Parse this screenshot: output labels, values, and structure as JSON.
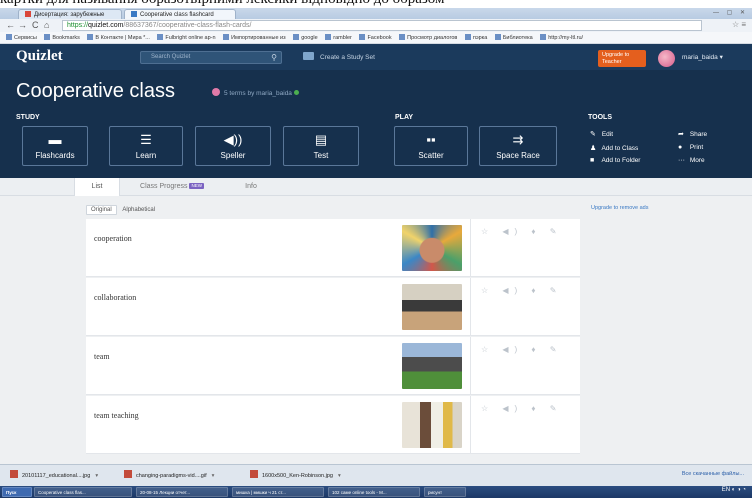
{
  "caption": "картки для називання образотвірними лексики відповідно до образом",
  "browser": {
    "tabs": [
      {
        "label": "Дисертация: зарубежные",
        "fav_color": "#d9473b"
      },
      {
        "label": "Cooperative class flashcard",
        "fav_color": "#3a79c4"
      }
    ],
    "url": {
      "scheme": "https://",
      "host": "quizlet.com",
      "path": "/88637367/cooperative-class-flash-cards/"
    },
    "bookmarks": [
      "Сервисы",
      "Bookmarks",
      "В Контакте | Мира *...",
      "Fulbright online ap-n",
      "Импортированные из",
      "google",
      "rambler",
      "Facebook",
      "Просмотр диалогов",
      "пэрка",
      "Библиотека",
      "http://my-ltl.ru/"
    ]
  },
  "quizlet": {
    "logo": "Quizlet",
    "search_placeholder": "Search Quizlet",
    "create": "Create a Study Set",
    "upgrade": "Upgrade to Teacher",
    "username": "maria_baida"
  },
  "set": {
    "title": "Cooperative class",
    "meta": "5 terms by maria_baida",
    "study_label": "STUDY",
    "play_label": "PLAY",
    "tools_label": "TOOLS",
    "study_modes": [
      {
        "name": "flashcards",
        "label": "Flashcards",
        "icon": "▬"
      },
      {
        "name": "learn",
        "label": "Learn",
        "icon": "☰"
      },
      {
        "name": "speller",
        "label": "Speller",
        "icon": "◀))"
      },
      {
        "name": "test",
        "label": "Test",
        "icon": "▤"
      }
    ],
    "play_modes": [
      {
        "name": "scatter",
        "label": "Scatter",
        "icon": "▪▪"
      },
      {
        "name": "space-race",
        "label": "Space Race",
        "icon": "⇉"
      }
    ],
    "tools_left": [
      {
        "name": "edit",
        "label": "Edit",
        "icon": "✎"
      },
      {
        "name": "add-to-class",
        "label": "Add to Class",
        "icon": "♟"
      },
      {
        "name": "add-to-folder",
        "label": "Add to Folder",
        "icon": "■"
      }
    ],
    "tools_right": [
      {
        "name": "share",
        "label": "Share",
        "icon": "➦"
      },
      {
        "name": "print",
        "label": "Print",
        "icon": "●"
      },
      {
        "name": "more",
        "label": "More",
        "icon": "···"
      }
    ]
  },
  "view_tabs": [
    {
      "name": "list",
      "label": "List",
      "active": true
    },
    {
      "name": "class-progress",
      "label": "Class Progress",
      "badge": "NEW"
    },
    {
      "name": "info",
      "label": "Info"
    }
  ],
  "sort": {
    "original": "Original",
    "alphabetical": "Alphabetical"
  },
  "remove_ads": "Upgrade to remove ads",
  "terms": [
    {
      "word": "cooperation",
      "photo": "stacked-hands-photo"
    },
    {
      "word": "collaboration",
      "photo": "group-at-table-photo"
    },
    {
      "word": "team",
      "photo": "team-on-grass-photo"
    },
    {
      "word": "team teaching",
      "photo": "two-teachers-photo"
    }
  ],
  "term_actions": "☆ ◀) ♦ ✎",
  "downloads": [
    {
      "label": "20101117_educational....jpg"
    },
    {
      "label": "changing-paradigms-vid....gif"
    },
    {
      "label": "1600x500_Ken-Robinson.jpg"
    }
  ],
  "downloads_all": "Все скачанные файлы...",
  "taskbar": [
    "Пуск",
    "Cooperative class flas...",
    "20-08-15 Лекции отчет...",
    "мишка | мишки ч 21 ст...",
    "102 саме online tools - M...",
    "рисунт"
  ],
  "tray": "EN ◐ ◑ ◔"
}
